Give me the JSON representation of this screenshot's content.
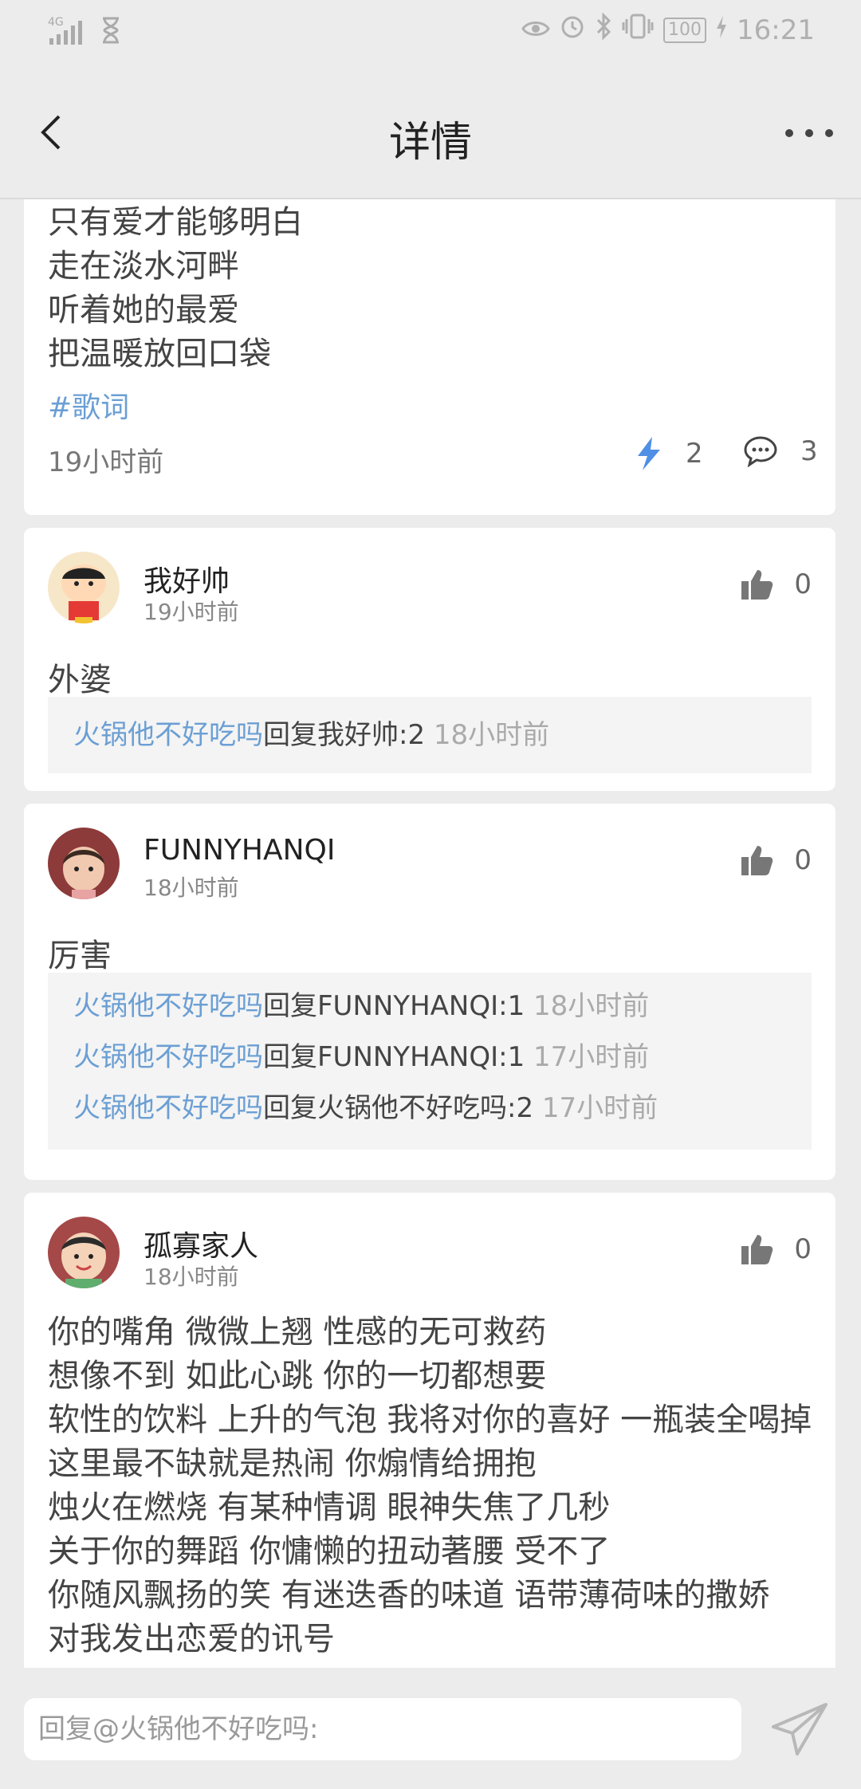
{
  "status_bar": {
    "signal": "4G",
    "battery": "100",
    "time": "16:21"
  },
  "header": {
    "title": "详情"
  },
  "post": {
    "lines": [
      "只有爱才能够明白",
      "走在淡水河畔",
      "听着她的最爱",
      "把温暖放回口袋"
    ],
    "hashtag": "#歌词",
    "time": "19小时前",
    "like_count": "2",
    "comment_count": "3"
  },
  "comments": [
    {
      "name": "我好帅",
      "time": "19小时前",
      "likes": "0",
      "text": "外婆",
      "replies": [
        {
          "user": "火锅他不好吃吗",
          "text": "回复我好帅:2",
          "time": "18小时前"
        }
      ]
    },
    {
      "name": "FUNNYHANQI",
      "time": "18小时前",
      "likes": "0",
      "text": "厉害",
      "replies": [
        {
          "user": "火锅他不好吃吗",
          "text": "回复FUNNYHANQI:1",
          "time": "18小时前"
        },
        {
          "user": "火锅他不好吃吗",
          "text": "回复FUNNYHANQI:1",
          "time": "17小时前"
        },
        {
          "user": "火锅他不好吃吗",
          "text": "回复火锅他不好吃吗:2",
          "time": "17小时前"
        }
      ]
    },
    {
      "name": "孤寡家人",
      "time": "18小时前",
      "likes": "0",
      "text_lines": [
        "你的嘴角 微微上翘 性感的无可救药",
        "想像不到 如此心跳 你的一切都想要",
        "软性的饮料 上升的气泡 我将对你的喜好 一瓶装全喝掉",
        "这里最不缺就是热闹 你煽情给拥抱",
        "烛火在燃烧 有某种情调 眼神失焦了几秒",
        "关于你的舞蹈 你慵懒的扭动著腰 受不了",
        "你随风飘扬的笑 有迷迭香的味道 语带薄荷味的撒娇",
        "对我发出恋爱的讯号"
      ]
    }
  ],
  "reply_bar": {
    "placeholder": "回复@火锅他不好吃吗:"
  },
  "colors": {
    "link": "#6b9fd4",
    "accent_bolt": "#4f8fe6",
    "background": "#ececec"
  }
}
